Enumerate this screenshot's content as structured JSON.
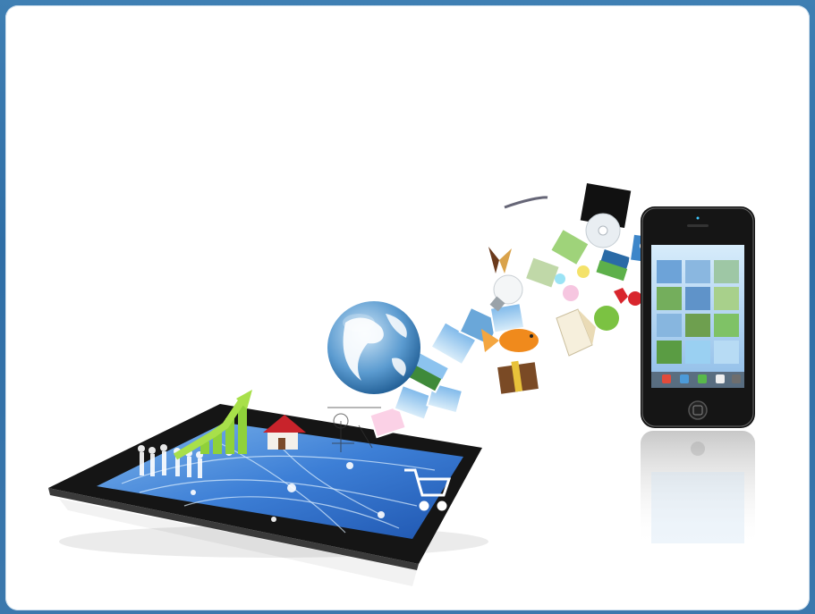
{
  "slide": {
    "background_color": "#2f6ea6",
    "panel_color": "#ffffff"
  },
  "illustration": {
    "tablet_screen_color": "#3d7fd6",
    "phone_screen_color": "#9cc6ee",
    "icons": [
      "globe-icon",
      "house-icon",
      "shopping-cart-icon",
      "bar-chart-icon",
      "butterfly-icon",
      "goldfish-icon",
      "light-bulb-icon",
      "book-icon",
      "apple-icon",
      "gift-box-icon",
      "cd-disc-icon"
    ]
  }
}
